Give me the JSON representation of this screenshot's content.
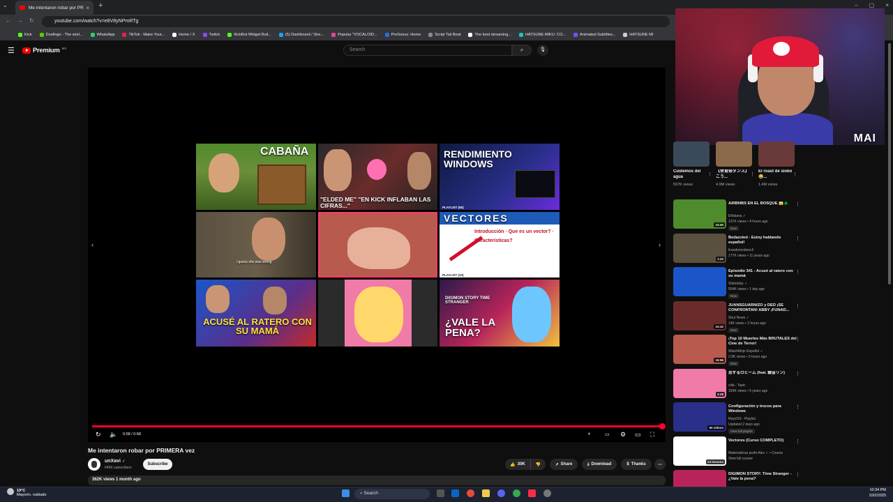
{
  "browser": {
    "tab_title": "Me intentaron robar por PRIMERA vez",
    "url": "youtube.com/watch?v=e8V8yNPmRTg",
    "bookmarks": [
      "Kick",
      "Duolingo - The worl...",
      "WhatsApp",
      "TikTok - Make Your...",
      "Home / X",
      "Twitch",
      "KickBot Widget Buil...",
      "(5) Dashboard / Stre...",
      "Popular \"VOCALOID...",
      "PreSonus: Home",
      "Script Tail Beat",
      "The best streaming...",
      "HATSUNE MIKU: CO...",
      "Animated Subtitles...",
      "HATSUNE MI"
    ],
    "bookmark_colors": [
      "#53fc18",
      "#58cc02",
      "#25d366",
      "#ee1d52",
      "#ffffff",
      "#9146ff",
      "#53fc18",
      "#1da1f2",
      "#e84393",
      "#2b6be4",
      "#888888",
      "#ffffff",
      "#21c1c1",
      "#7c4dff",
      "#cccccc"
    ]
  },
  "youtube": {
    "logo_word": "Premium",
    "country": "MX",
    "search_placeholder": "Search"
  },
  "player": {
    "grid_captions": [
      "CABAÑA",
      "\"ELDED ME\" \"EN KICK INFLABAN LAS CIFRAS...\"",
      "RENDIMIENTO WINDOWS",
      "",
      "",
      "VECTORES",
      "ACUSÉ AL RATERO CON SU MAMÁ",
      "",
      "¿VALE LA PENA?"
    ],
    "grid_sub": [
      "",
      "",
      "PLAYLIST (50)",
      "i guess she was wrong",
      "",
      "Introducción · Que es un vector? · Características?",
      "",
      "",
      "DIGIMON STORY TIME STRANGER"
    ],
    "vec_playlist": "PLAYLIST (24)",
    "time": "0:58 / 0:58",
    "progress": 1.0
  },
  "video": {
    "title": "Me intentaron robar por PRIMERA vez",
    "channel": "unXavi",
    "subscribers": "640K subscribers",
    "subscribe": "Subscribe",
    "likes": "30K",
    "share": "Share",
    "download": "Download",
    "thanks": "Thanks",
    "meta": "362K views  1 month ago"
  },
  "webcam": {
    "overlay": "MAI"
  },
  "shorts": [
    {
      "title": "Cuidemos del agua",
      "views": "597K views",
      "color": "#3a4a5a"
    },
    {
      "title": "【休育祭ダンス】こう...",
      "views": "4.9M views",
      "color": "#8a6a4a"
    },
    {
      "title": "El roast de slobo 😂...",
      "views": "1.4M views",
      "color": "#6a3a3a"
    }
  ],
  "recommendations": [
    {
      "title": "AIRBNBS EN EL BOSQUE 😱🌲",
      "channel": "Elfatiana ✓",
      "views": "137K views • 4 hours ago",
      "new": "New",
      "duration": "24:50",
      "color": "#4f8a2c"
    },
    {
      "title": "Bedazzled - Estoy hablando español!",
      "channel": "lirandomvideoclì",
      "views": "177K views • 11 years ago",
      "new": "",
      "duration": "1:22",
      "color": "#5a5040"
    },
    {
      "title": "Episodio 341 - Acusé al ratero con su mamá",
      "channel": "Slobotzky ✓",
      "views": "554K views • 1 day ago",
      "new": "New",
      "duration": "",
      "color": "#1a56c8"
    },
    {
      "title": "JUANSGUARNIZO y DED ¡SE CONFRONTAN! ABBY ¡FUNAD...",
      "channel": "Shut News ✓",
      "views": "14K views • 2 hours ago",
      "new": "New",
      "duration": "24:42",
      "color": "#6a2b2b"
    },
    {
      "title": "¡Top 10 Muertes Más BRUTALES del Cine de Terror!",
      "channel": "WatchMojo Español ✓",
      "views": "2.9K views • 3 hours ago",
      "new": "New",
      "duration": "15:56",
      "color": "#b85a4e"
    },
    {
      "title": "恋するロビーム (feat. 鏡音リン)",
      "channel": "cilla - Topic",
      "views": "154K views • 5 years ago",
      "new": "",
      "duration": "4:28",
      "color": "#f07aa8"
    },
    {
      "title": "Configuración y trucos para Windows",
      "channel": "ReyzOS - Playlist",
      "views": "Updated 2 days ago",
      "new": "View full playlist",
      "duration": "50 videos",
      "color": "#2a2f8a"
    },
    {
      "title": "Vectores (Curso COMPLETO)",
      "channel": "Matemáticas profe Alex ✓ • Course",
      "views": "View full course",
      "new": "",
      "duration": "24 lessons",
      "color": "#ffffff"
    },
    {
      "title": "DIGIMON STORY: Time Stranger - ¿Vale la pena?",
      "channel": "",
      "views": "",
      "new": "",
      "duration": "",
      "color": "#b8245a"
    }
  ],
  "taskbar": {
    "temp": "19°C",
    "weather": "Mayorm. nublado",
    "search": "Search",
    "time": "10:34 PM",
    "date": "10/2/2025"
  }
}
